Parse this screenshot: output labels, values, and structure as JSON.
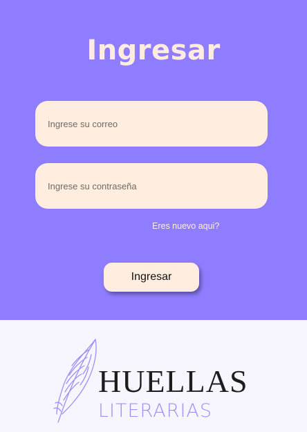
{
  "colors": {
    "primary": "#8f7dff",
    "input_bg": "#ffeddf",
    "footer_bg": "#f7f6ff",
    "title_text": "#ffece0",
    "logo_main": "#1e1c1c",
    "logo_sub": "#9f8ef2"
  },
  "login": {
    "title": "Ingresar",
    "email_placeholder": "Ingrese su correo",
    "password_placeholder": "Ingrese su contraseña",
    "register_link": "Eres nuevo aqui?",
    "submit_label": "Ingresar"
  },
  "logo": {
    "icon": "feather-icon",
    "main": "HUELLAS",
    "sub": "LITERARIAS"
  }
}
